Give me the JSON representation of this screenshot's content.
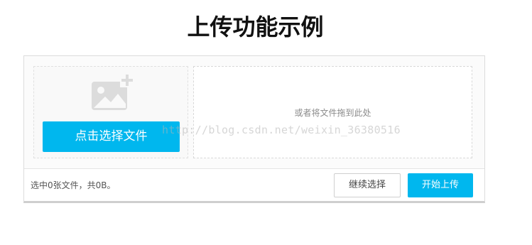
{
  "page": {
    "title": "上传功能示例"
  },
  "uploader": {
    "pick_button_label": "点击选择文件",
    "drop_hint": "或者将文件拖到此处",
    "pick_icon": "image-add-icon",
    "status_text": "选中0张文件，共0B。",
    "continue_label": "继续选择",
    "start_label": "开始上传",
    "accent_color": "#00b7ee"
  },
  "watermark": {
    "text": "http://blog.csdn.net/weixin_36380516"
  }
}
